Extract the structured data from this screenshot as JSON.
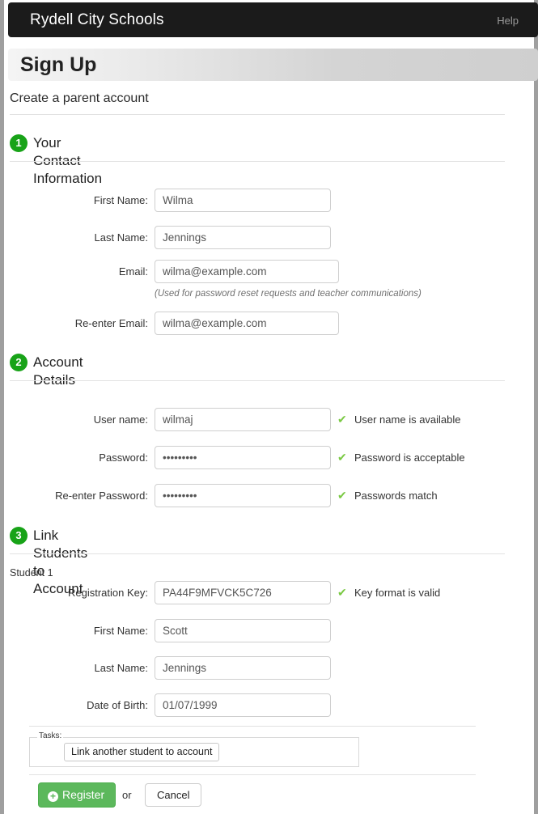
{
  "navbar": {
    "brand": "Rydell City Schools",
    "help_label": "Help"
  },
  "header": {
    "page_title": "Sign Up",
    "subtitle": "Create a parent account"
  },
  "colors": {
    "navbar_bg": "#1b1b1b",
    "badge_green": "#18a318",
    "register_green": "#5cb85c",
    "check_green": "#7ac943",
    "banner_gradient_start": "#f4f4f4",
    "banner_gradient_end": "#cfcfcf"
  },
  "sections": [
    {
      "number": "1",
      "title": "Your Contact Information",
      "fields": [
        {
          "label": "First Name:",
          "value": "Wilma",
          "placeholder": ""
        },
        {
          "label": "Last Name:",
          "value": "Jennings",
          "placeholder": ""
        },
        {
          "label": "Email:",
          "value": "wilma@example.com",
          "placeholder": ""
        },
        {
          "label": "Re-enter Email:",
          "value": "wilma@example.com",
          "placeholder": ""
        }
      ],
      "hint": "(Used for password reset requests and teacher communications)"
    },
    {
      "number": "2",
      "title": "Account Details",
      "fields": [
        {
          "label": "User name:",
          "value": "wilmaj",
          "validation": "User name is available"
        },
        {
          "label": "Password:",
          "value": "•••••••••",
          "validation": "Password is acceptable"
        },
        {
          "label": "Re-enter Password:",
          "value": "•••••••••",
          "validation": "Passwords match"
        }
      ]
    },
    {
      "number": "3",
      "title": "Link Students to Account",
      "student_label": "Student 1",
      "fields": [
        {
          "label": "Registration Key:",
          "value": "PA44F9MFVCK5C726",
          "validation": "Key format is valid"
        },
        {
          "label": "First Name:",
          "value": "Scott"
        },
        {
          "label": "Last Name:",
          "value": "Jennings"
        },
        {
          "label": "Date of Birth:",
          "value": "01/07/1999"
        }
      ]
    }
  ],
  "tasks": {
    "legend": "Tasks:",
    "link_another_student_label": "Link another student to account"
  },
  "footer": {
    "register_label": "Register",
    "or_label": "or",
    "cancel_label": "Cancel",
    "plus_glyph": "+"
  },
  "icons": {
    "check": "✔"
  }
}
